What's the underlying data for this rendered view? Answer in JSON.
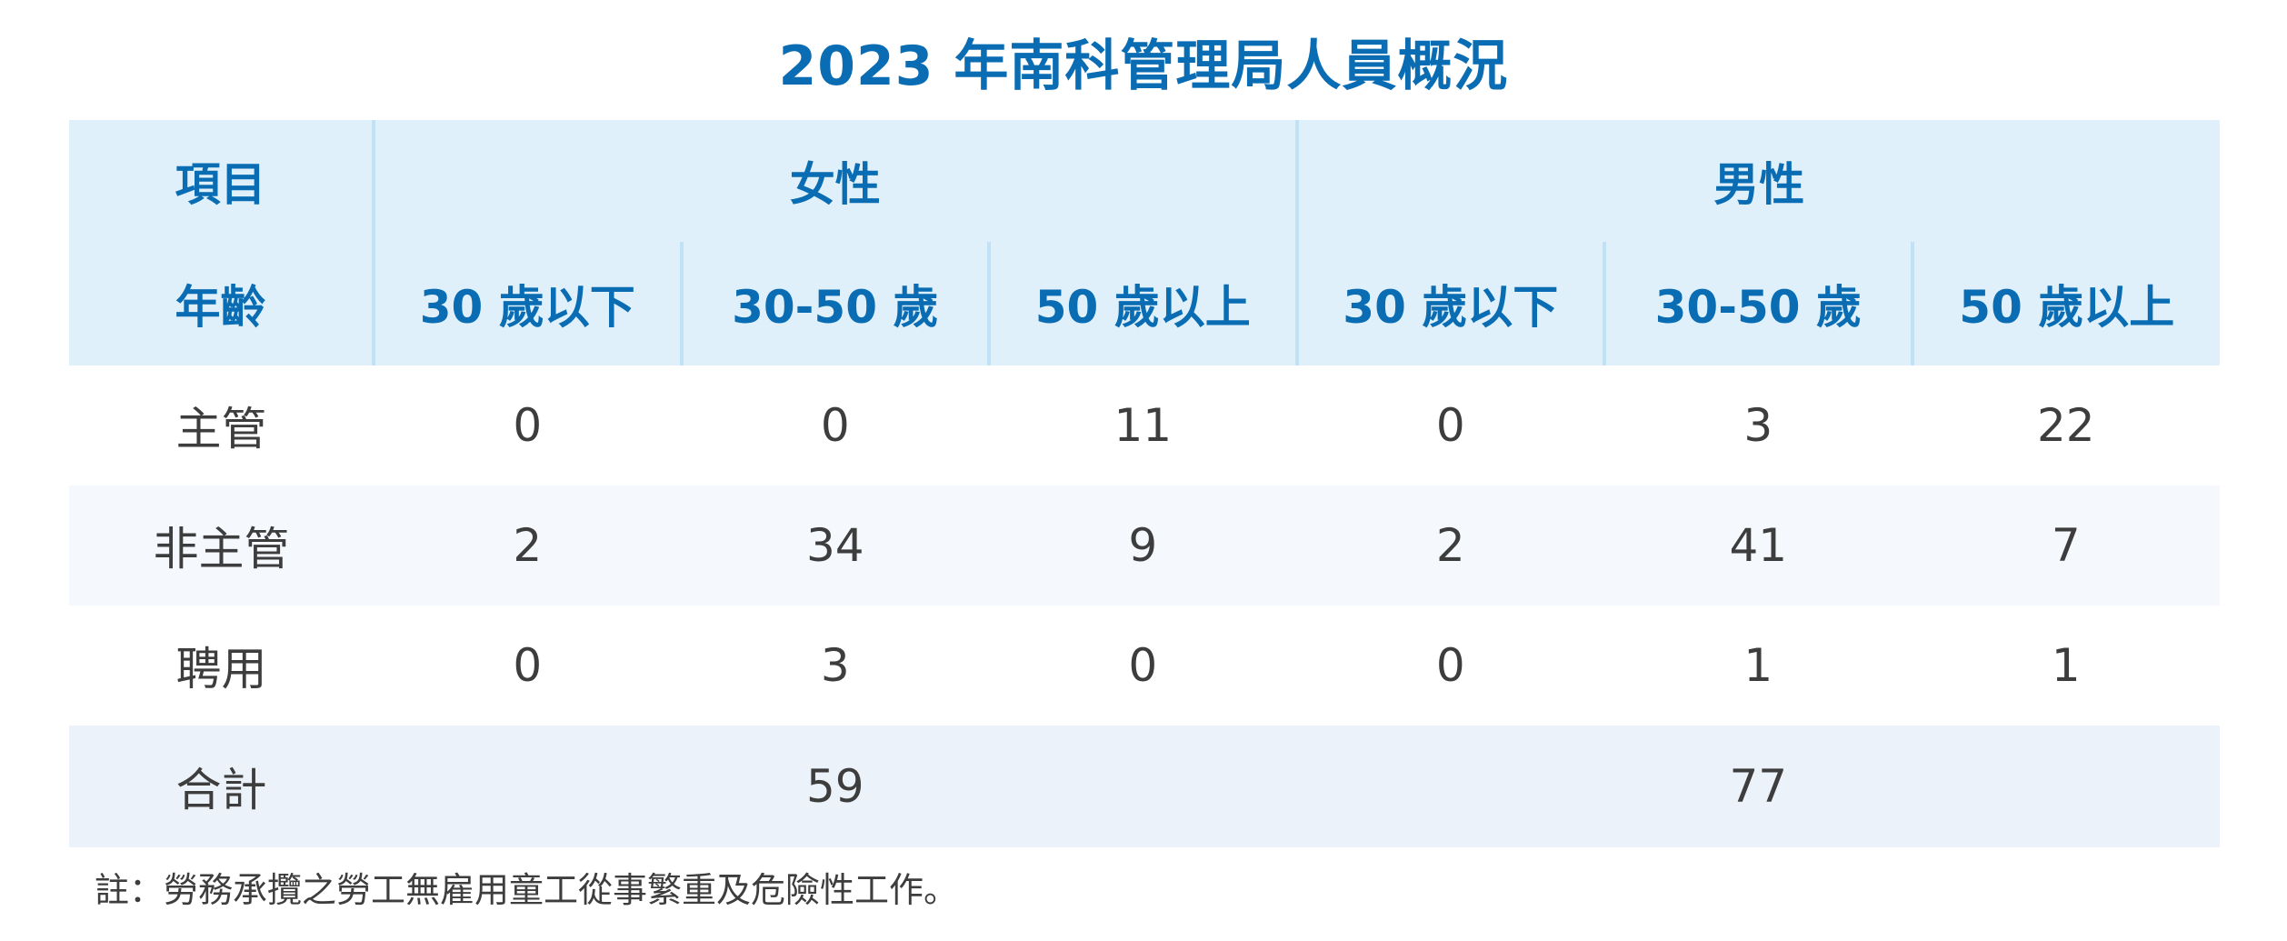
{
  "title": "2023 年南科管理局人員概況",
  "header": {
    "item_label": "項目",
    "age_label": "年齡",
    "female_label": "女性",
    "male_label": "男性",
    "female_ages": [
      "30 歲以下",
      "30-50 歲",
      "50 歲以上"
    ],
    "male_ages": [
      "30 歲以下",
      "30-50 歲",
      "50 歲以上"
    ]
  },
  "rows": [
    {
      "label": "主管",
      "values": [
        "0",
        "0",
        "11",
        "0",
        "3",
        "22"
      ]
    },
    {
      "label": "非主管",
      "values": [
        "2",
        "34",
        "9",
        "2",
        "41",
        "7"
      ]
    },
    {
      "label": "聘用",
      "values": [
        "0",
        "3",
        "0",
        "0",
        "1",
        "1"
      ]
    }
  ],
  "total": {
    "label": "合計",
    "female": "59",
    "male": "77"
  },
  "note": "註：勞務承攬之勞工無雇用童工從事繁重及危險性工作。",
  "colors": {
    "accent": "#0a6db3",
    "header_bg": "#dff0fa",
    "separator": "#bfe2f6",
    "row_light": "#f5f8fd",
    "row_total": "#ecf2f9",
    "text": "#3d3d3d"
  }
}
